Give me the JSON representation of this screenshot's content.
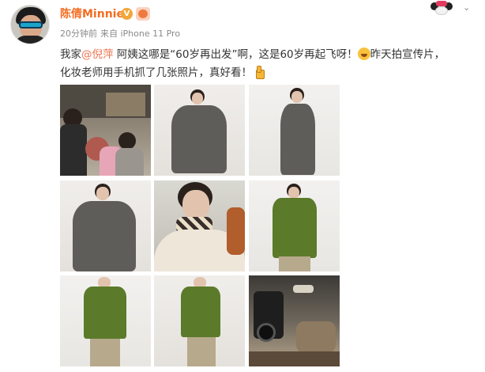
{
  "post": {
    "username": "陈倩Minnie",
    "verified_badge": "V",
    "time": "20分钟前",
    "source": "来自 iPhone 11 Pro",
    "text_1_before_mention": "我家",
    "mention": "@倪萍",
    "text_1_after_mention": " 阿姨这哪是“60岁再出发”啊，这是60岁再起飞呀！",
    "text_1_tail": "昨天拍宣传片，",
    "text_2": "化妆老师用手机抓了几张照片，真好看！"
  },
  "colors": {
    "username": "#f36c21",
    "mention": "#eb7350",
    "meta": "#8a8a8a",
    "text": "#333333"
  },
  "icons": {
    "verified": "verified-v-icon",
    "level": "weibo-level-icon",
    "emoji_laugh": "laugh-cry-emoji-icon",
    "emoji_thumb": "thumbs-up-emoji-icon",
    "more": "chevron-down-icon"
  },
  "photos": [
    {
      "label": "behind-the-scenes makeup"
    },
    {
      "label": "grey cape pose 1"
    },
    {
      "label": "grey cape pose 2"
    },
    {
      "label": "grey cape full"
    },
    {
      "label": "scarf closeup"
    },
    {
      "label": "green jacket 1"
    },
    {
      "label": "green jacket 2"
    },
    {
      "label": "green jacket 3"
    },
    {
      "label": "camera set"
    }
  ]
}
